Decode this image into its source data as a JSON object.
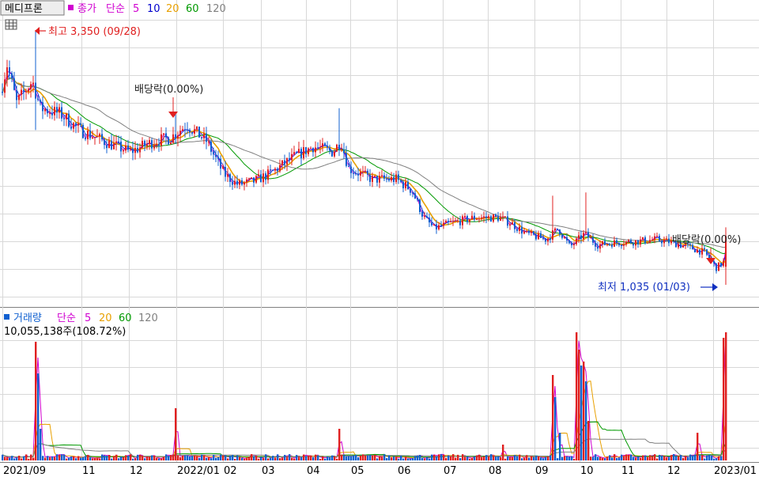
{
  "header": {
    "stock_name": "메디프론",
    "price_label": "종가",
    "ma_label": "단순",
    "ma_periods": [
      "5",
      "10",
      "20",
      "60",
      "120"
    ],
    "ma_colors": [
      "#d000d0",
      "#0000cc",
      "#e8a000",
      "#009900",
      "#808080"
    ]
  },
  "volume_header": {
    "label": "거래량",
    "ma_label": "단순",
    "ma_periods": [
      "5",
      "20",
      "60",
      "120"
    ],
    "last_volume": "10,055,138주(108.72%)"
  },
  "annotations": {
    "high": "최고 3,350 (09/28)",
    "low": "최저 1,035 (01/03)",
    "dividend_1": "배당락(0.00%)",
    "dividend_2": "배당락(0.00%)"
  },
  "x_axis_labels": [
    "2021/09",
    "11",
    "12",
    "2022/01",
    "02",
    "03",
    "04",
    "05",
    "06",
    "07",
    "08",
    "09",
    "10",
    "11",
    "12",
    "2023/01"
  ],
  "colors": {
    "up": "#e02020",
    "down": "#1060d0",
    "grid": "#d8d8d8"
  },
  "chart_data": {
    "type": "candlestick",
    "y_range_estimate": [
      900,
      3500
    ],
    "highest": {
      "value": 3350,
      "date": "09/28"
    },
    "lowest": {
      "value": 1035,
      "date": "01/03"
    },
    "monthly_close_estimate": {
      "x": [
        "2021/09",
        "11",
        "12",
        "2022/01",
        "02",
        "03",
        "04",
        "05",
        "06",
        "07",
        "08",
        "09",
        "10",
        "11",
        "12",
        "2023/01"
      ],
      "y": [
        2900,
        2450,
        2300,
        2380,
        2100,
        1900,
        2150,
        2000,
        1850,
        1600,
        1580,
        1430,
        1450,
        1400,
        1180,
        1300
      ]
    }
  }
}
